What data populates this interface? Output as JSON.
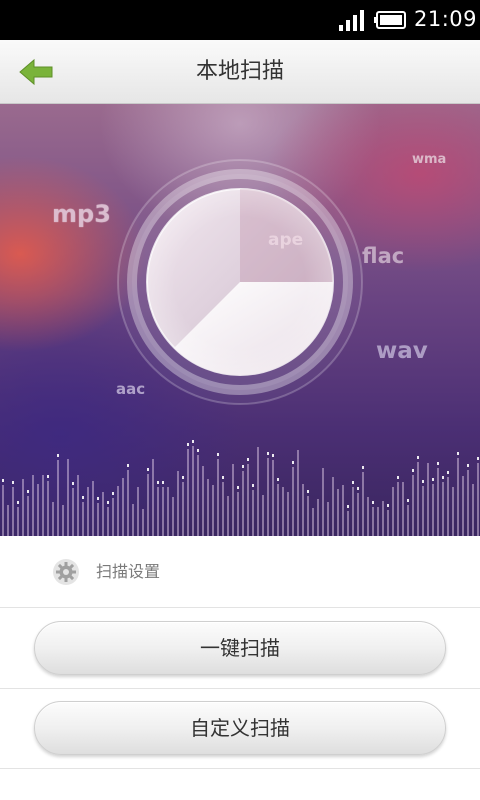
{
  "status_bar": {
    "time": "21:09",
    "signal_icon": "signal-bars-icon",
    "battery_icon": "battery-icon"
  },
  "header": {
    "title": "本地扫描",
    "back_icon": "back-arrow-icon",
    "back_icon_color": "#7ab33a"
  },
  "scan_visual": {
    "formats": [
      "mp3",
      "ape",
      "flac",
      "wma",
      "wav",
      "aac"
    ],
    "progress_fraction": 0.375,
    "progress_icon": "scan-progress-pie-icon"
  },
  "settings": {
    "icon": "gear-icon",
    "label": "扫描设置"
  },
  "actions": {
    "one_key_scan": "一键扫描",
    "custom_scan": "自定义扫描"
  },
  "colors": {
    "header_bg": "#ececec",
    "status_bar_bg": "#000000",
    "panel_purple": "#5a3a7a"
  }
}
